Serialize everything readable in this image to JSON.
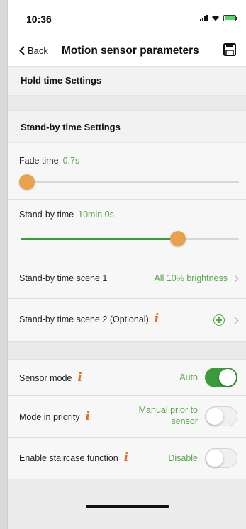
{
  "status_bar": {
    "time": "10:36"
  },
  "nav": {
    "back_label": "Back",
    "title": "Motion sensor parameters"
  },
  "sections": {
    "hold_time": "Hold time Settings",
    "standby_time": "Stand-by time Settings"
  },
  "fade_time": {
    "label": "Fade time",
    "value": "0.7s",
    "slider_fraction": 0.04
  },
  "standby_time": {
    "label": "Stand-by time",
    "value": "10min 0s",
    "slider_fraction": 0.72
  },
  "scene1": {
    "label": "Stand-by time scene 1",
    "value": "All 10% brightness"
  },
  "scene2": {
    "label": "Stand-by time scene 2 (Optional)"
  },
  "sensor_mode": {
    "label": "Sensor mode",
    "value": "Auto",
    "on": true
  },
  "mode_priority": {
    "label": "Mode in priority",
    "value_line1": "Manual prior to",
    "value_line2": "sensor",
    "on": false
  },
  "staircase": {
    "label": "Enable staircase function",
    "value": "Disable",
    "on": false
  },
  "colors": {
    "accent": "#58a84a",
    "toggle_on": "#3b9a3b",
    "thumb": "#e8a24d",
    "info": "#e07020"
  },
  "icons": {
    "info": "info-icon",
    "save": "save-icon",
    "add": "add-circle-icon",
    "chevron": "chevron-right-icon",
    "back": "chevron-left-icon"
  }
}
